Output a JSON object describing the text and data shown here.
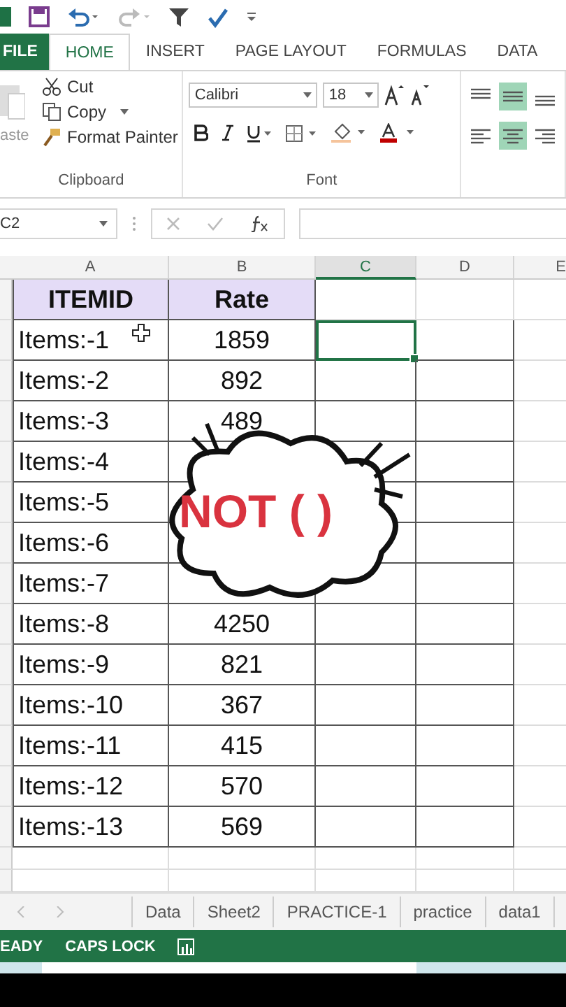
{
  "ribbon_tabs": [
    {
      "label": "FILE",
      "kind": "file",
      "selected": false
    },
    {
      "label": "HOME",
      "kind": "tab",
      "selected": true
    },
    {
      "label": "INSERT",
      "kind": "tab",
      "selected": false
    },
    {
      "label": "PAGE LAYOUT",
      "kind": "tab",
      "selected": false
    },
    {
      "label": "FORMULAS",
      "kind": "tab",
      "selected": false
    },
    {
      "label": "DATA",
      "kind": "tab",
      "selected": false
    }
  ],
  "clipboard": {
    "paste": "aste",
    "cut": "Cut",
    "copy": "Copy",
    "format_painter": "Format Painter",
    "group_label": "Clipboard"
  },
  "font": {
    "name": "Calibri",
    "size": "18",
    "group_label": "Font"
  },
  "align_buttons": [
    {
      "kind": "top",
      "selected": false
    },
    {
      "kind": "middle",
      "selected": true
    },
    {
      "kind": "bottom",
      "selected": false
    },
    {
      "kind": "left",
      "selected": false
    },
    {
      "kind": "center",
      "selected": true
    },
    {
      "kind": "right",
      "selected": false
    }
  ],
  "name_box": "C2",
  "columns": [
    {
      "label": "A",
      "selected": false
    },
    {
      "label": "B",
      "selected": false
    },
    {
      "label": "C",
      "selected": true
    },
    {
      "label": "D",
      "selected": false
    },
    {
      "label": "E",
      "selected": false
    }
  ],
  "header_row": [
    "ITEMID",
    "Rate"
  ],
  "rows": [
    {
      "item": "Items:-1",
      "rate": "1859",
      "selected_c": true
    },
    {
      "item": "Items:-2",
      "rate": "892",
      "selected_c": false
    },
    {
      "item": "Items:-3",
      "rate": "489",
      "selected_c": false
    },
    {
      "item": "Items:-4",
      "selected_c": false
    },
    {
      "item": "Items:-5",
      "selected_c": false
    },
    {
      "item": "Items:-6",
      "selected_c": false
    },
    {
      "item": "Items:-7",
      "selected_c": false
    },
    {
      "item": "Items:-8",
      "rate": "4250",
      "selected_c": false
    },
    {
      "item": "Items:-9",
      "rate": "821",
      "selected_c": false
    },
    {
      "item": "Items:-10",
      "rate": "367",
      "selected_c": false
    },
    {
      "item": "Items:-11",
      "rate": "415",
      "selected_c": false
    },
    {
      "item": "Items:-12",
      "rate": "570",
      "selected_c": false
    },
    {
      "item": "Items:-13",
      "rate": "569",
      "selected_c": false
    }
  ],
  "overlay": {
    "text": "NOT ( )"
  },
  "sheet_tabs": [
    {
      "label": "Data",
      "selected": false
    },
    {
      "label": "Sheet2",
      "selected": false
    },
    {
      "label": "PRACTICE-1",
      "selected": false
    },
    {
      "label": "practice",
      "selected": false
    },
    {
      "label": "data1",
      "selected": false
    }
  ],
  "status_bar": {
    "mode": "EADY",
    "caps": "CAPS LOCK"
  }
}
